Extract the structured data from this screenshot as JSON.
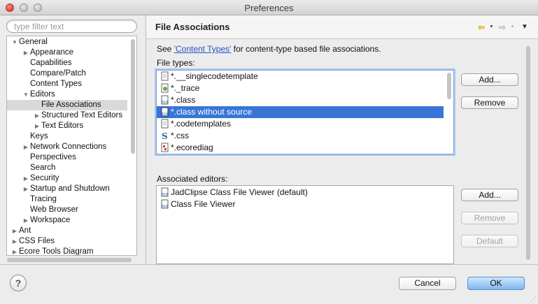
{
  "window": {
    "title": "Preferences"
  },
  "filter": {
    "placeholder": "type filter text"
  },
  "tree": {
    "items": [
      {
        "label": "General",
        "expanded": true
      },
      {
        "label": "Appearance",
        "expanded": false
      },
      {
        "label": "Capabilities"
      },
      {
        "label": "Compare/Patch"
      },
      {
        "label": "Content Types"
      },
      {
        "label": "Editors",
        "expanded": true
      },
      {
        "label": "File Associations",
        "selected": true
      },
      {
        "label": "Structured Text Editors",
        "expanded": false
      },
      {
        "label": "Text Editors",
        "expanded": false
      },
      {
        "label": "Keys"
      },
      {
        "label": "Network Connections",
        "expanded": false
      },
      {
        "label": "Perspectives"
      },
      {
        "label": "Search"
      },
      {
        "label": "Security",
        "expanded": false
      },
      {
        "label": "Startup and Shutdown",
        "expanded": false
      },
      {
        "label": "Tracing"
      },
      {
        "label": "Web Browser"
      },
      {
        "label": "Workspace",
        "expanded": false
      },
      {
        "label": "Ant",
        "expanded": false
      },
      {
        "label": "CSS Files",
        "expanded": false
      },
      {
        "label": "Ecore Tools Diagram",
        "expanded": false
      }
    ]
  },
  "page": {
    "title": "File Associations",
    "see_prefix": "See ",
    "see_link": "'Content Types'",
    "see_suffix": " for content-type based file associations.",
    "file_types_label": "File types:",
    "associated_label": "Associated editors:"
  },
  "file_types": [
    {
      "label": "*.__singlecodetemplate",
      "icon": "doc-icon"
    },
    {
      "label": "*._trace",
      "icon": "trace-icon"
    },
    {
      "label": "*.class",
      "icon": "class-icon"
    },
    {
      "label": "*.class without source",
      "icon": "class-icon",
      "selected": true
    },
    {
      "label": "*.codetemplates",
      "icon": "doc-icon"
    },
    {
      "label": "*.css",
      "icon": "css-icon"
    },
    {
      "label": "*.ecorediag",
      "icon": "diagram-icon"
    }
  ],
  "editors": [
    {
      "label": "JadClipse Class File Viewer (default)",
      "icon": "class-icon"
    },
    {
      "label": "Class File Viewer",
      "icon": "class-icon"
    }
  ],
  "buttons": {
    "types_add": "Add...",
    "types_remove": "Remove",
    "editors_add": "Add...",
    "editors_remove": "Remove",
    "editors_default": "Default",
    "cancel": "Cancel",
    "ok": "OK"
  },
  "nav": {
    "back": "⇦",
    "forward": "⇨",
    "dropdown": "▼",
    "menu": "▼"
  },
  "help": {
    "glyph": "?"
  },
  "colors": {
    "selection": "#3875d7",
    "link": "#2b50c9",
    "tree_selection": "#d9d9d9"
  }
}
